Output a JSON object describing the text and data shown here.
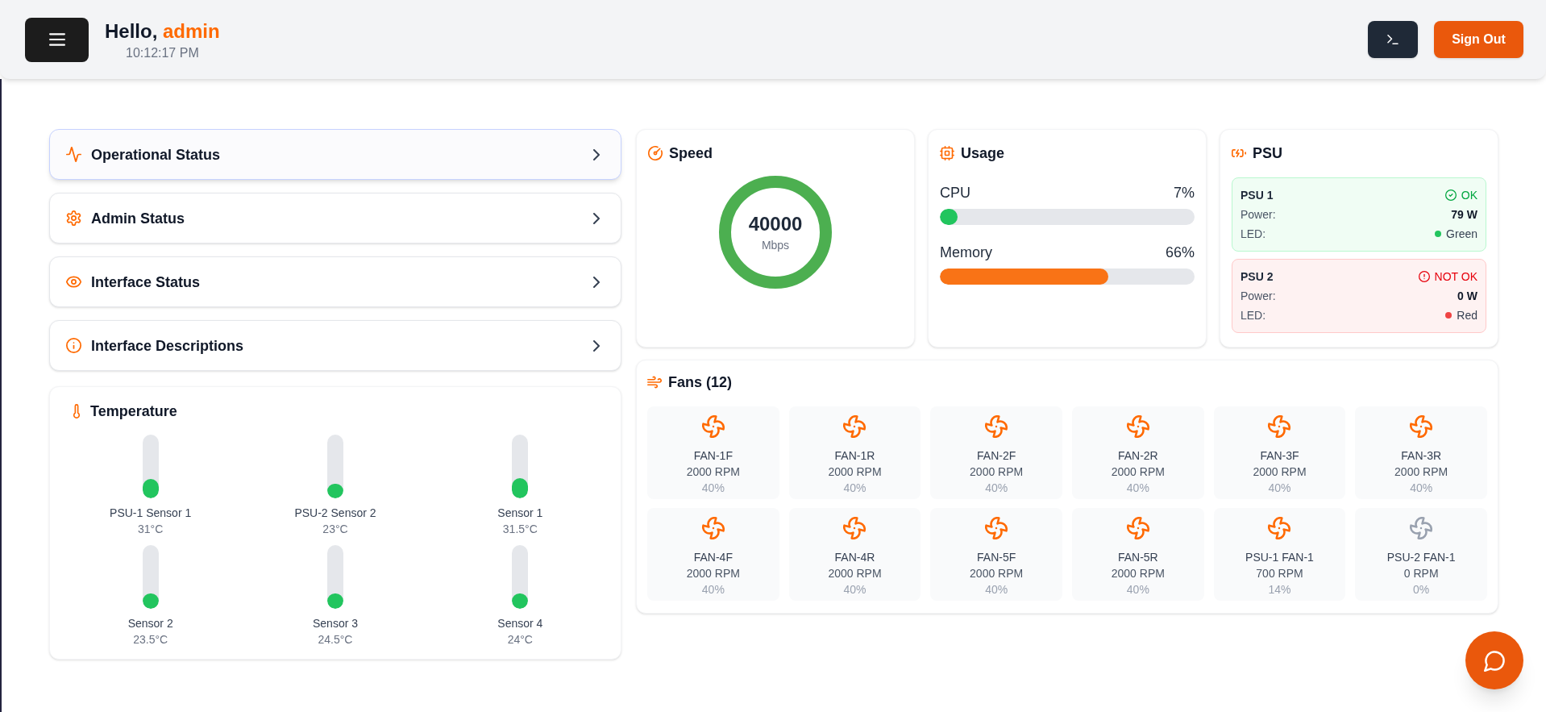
{
  "header": {
    "greeting": "Hello,",
    "username": "admin",
    "time": "10:12:17 PM",
    "sign_out": "Sign Out"
  },
  "nav": [
    {
      "kind": "operational",
      "label": "Operational Status",
      "selected": true
    },
    {
      "kind": "admin",
      "label": "Admin Status",
      "selected": false
    },
    {
      "kind": "interface",
      "label": "Interface Status",
      "selected": false
    },
    {
      "kind": "descriptions",
      "label": "Interface Descriptions",
      "selected": false
    }
  ],
  "temperature": {
    "title": "Temperature",
    "sensors": [
      {
        "name": "PSU-1 Sensor 1",
        "reading": "31°C",
        "level": 0.31
      },
      {
        "name": "PSU-2 Sensor 2",
        "reading": "23°C",
        "level": 0.23
      },
      {
        "name": "Sensor 1",
        "reading": "31.5°C",
        "level": 0.315
      },
      {
        "name": "Sensor 2",
        "reading": "23.5°C",
        "level": 0.235
      },
      {
        "name": "Sensor 3",
        "reading": "24.5°C",
        "level": 0.245
      },
      {
        "name": "Sensor 4",
        "reading": "24°C",
        "level": 0.24
      }
    ]
  },
  "speed": {
    "title": "Speed",
    "value": "40000",
    "unit": "Mbps"
  },
  "usage": {
    "title": "Usage",
    "meters": [
      {
        "name": "CPU",
        "reading": "7%",
        "level": 0.07,
        "color": "#22c55e"
      },
      {
        "name": "Memory",
        "reading": "66%",
        "level": 0.66,
        "color": "#f97316"
      }
    ]
  },
  "psu": {
    "title": "PSU",
    "units": [
      {
        "name": "PSU 1",
        "ok": true,
        "status": "OK",
        "power_label": "Power:",
        "power": "79 W",
        "led_label": "LED:",
        "led": "Green",
        "color": "#22c55e"
      },
      {
        "name": "PSU 2",
        "ok": false,
        "status": "NOT OK",
        "power_label": "Power:",
        "power": "0 W",
        "led_label": "LED:",
        "led": "Red",
        "color": "#ef4444"
      }
    ]
  },
  "fans": {
    "title": "Fans (12)",
    "items": [
      {
        "name": "FAN-1F",
        "rpm": "2000 RPM",
        "duty": "40%",
        "running": true
      },
      {
        "name": "FAN-1R",
        "rpm": "2000 RPM",
        "duty": "40%",
        "running": true
      },
      {
        "name": "FAN-2F",
        "rpm": "2000 RPM",
        "duty": "40%",
        "running": true
      },
      {
        "name": "FAN-2R",
        "rpm": "2000 RPM",
        "duty": "40%",
        "running": true
      },
      {
        "name": "FAN-3F",
        "rpm": "2000 RPM",
        "duty": "40%",
        "running": true
      },
      {
        "name": "FAN-3R",
        "rpm": "2000 RPM",
        "duty": "40%",
        "running": true
      },
      {
        "name": "FAN-4F",
        "rpm": "2000 RPM",
        "duty": "40%",
        "running": true
      },
      {
        "name": "FAN-4R",
        "rpm": "2000 RPM",
        "duty": "40%",
        "running": true
      },
      {
        "name": "FAN-5F",
        "rpm": "2000 RPM",
        "duty": "40%",
        "running": true
      },
      {
        "name": "FAN-5R",
        "rpm": "2000 RPM",
        "duty": "40%",
        "running": true
      },
      {
        "name": "PSU-1 FAN-1",
        "rpm": "700 RPM",
        "duty": "14%",
        "running": true
      },
      {
        "name": "PSU-2 FAN-1",
        "rpm": "0 RPM",
        "duty": "0%",
        "running": false
      }
    ]
  }
}
